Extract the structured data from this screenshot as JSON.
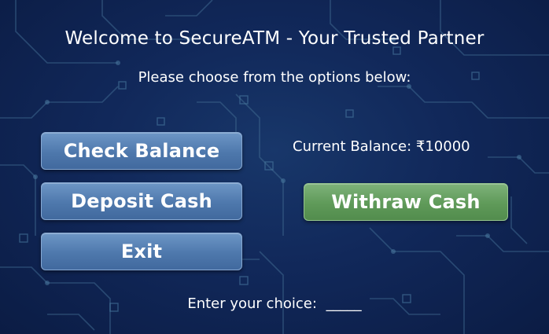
{
  "header": {
    "title": "Welcome to SecureATM - Your Trusted Partner",
    "subtitle": "Please choose from the options below:"
  },
  "menu": {
    "check_balance": "Check Balance",
    "deposit_cash": "Deposit Cash",
    "exit": "Exit",
    "withdraw_cash": "Withraw Cash"
  },
  "balance": {
    "text": "Current Balance: ₹10000"
  },
  "prompt": {
    "label": "Enter your choice:",
    "blank": "_____"
  },
  "colors": {
    "background": "#11285a",
    "button_blue": "#4e78ac",
    "button_green": "#5f9a59",
    "text": "#ffffff"
  }
}
